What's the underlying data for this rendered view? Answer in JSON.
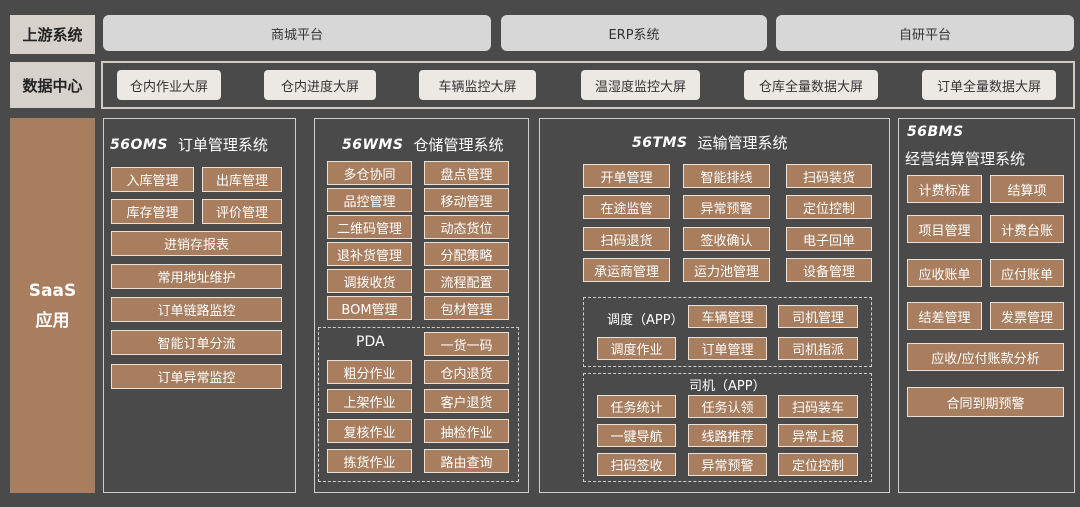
{
  "upstream": {
    "label": "上游系统",
    "platforms": [
      "商城平台",
      "ERP系统",
      "自研平台"
    ]
  },
  "datacenter": {
    "label": "数据中心",
    "items": [
      "仓内作业大屏",
      "仓内进度大屏",
      "车辆监控大屏",
      "温湿度监控大屏",
      "仓库全量数据大屏",
      "订单全量数据大屏"
    ]
  },
  "saas": {
    "line1": "SaaS",
    "line2": "应用"
  },
  "oms": {
    "logo": "56OMS",
    "title": "订单管理系统",
    "pairs": [
      [
        "入库管理",
        "出库管理"
      ],
      [
        "库存管理",
        "评价管理"
      ]
    ],
    "singles": [
      "进销存报表",
      "常用地址维护",
      "订单链路监控",
      "智能订单分流",
      "订单异常监控"
    ]
  },
  "wms": {
    "logo": "56WMS",
    "title": "仓储管理系统",
    "grid": [
      [
        "多仓协同",
        "盘点管理"
      ],
      [
        "品控管理",
        "移动管理"
      ],
      [
        "二维码管理",
        "动态货位"
      ],
      [
        "退补货管理",
        "分配策略"
      ],
      [
        "调拨收货",
        "流程配置"
      ],
      [
        "BOM管理",
        "包材管理"
      ]
    ],
    "pda_label": "PDA",
    "pda_top": "一货一码",
    "pda_grid": [
      [
        "粗分作业",
        "仓内退货"
      ],
      [
        "上架作业",
        "客户退货"
      ],
      [
        "复核作业",
        "抽检作业"
      ],
      [
        "拣货作业",
        "路由查询"
      ]
    ]
  },
  "tms": {
    "logo": "56TMS",
    "title": "运输管理系统",
    "grid": [
      [
        "开单管理",
        "智能排线",
        "扫码装货"
      ],
      [
        "在途监管",
        "异常预警",
        "定位控制"
      ],
      [
        "扫码退货",
        "签收确认",
        "电子回单"
      ],
      [
        "承运商管理",
        "运力池管理",
        "设备管理"
      ]
    ],
    "dispatch_label": "调度（APP）",
    "dispatch_row1": [
      "车辆管理",
      "司机管理"
    ],
    "dispatch_row2": [
      "调度作业",
      "订单管理",
      "司机指派"
    ],
    "driver_label": "司机（APP）",
    "driver_grid": [
      [
        "任务统计",
        "任务认领",
        "扫码装车"
      ],
      [
        "一键导航",
        "线路推荐",
        "异常上报"
      ],
      [
        "扫码签收",
        "异常预警",
        "定位控制"
      ]
    ]
  },
  "bms": {
    "logo": "56BMS",
    "title": "经营结算管理系统",
    "grid": [
      [
        "计费标准",
        "结算项"
      ],
      [
        "项目管理",
        "计费台账"
      ],
      [
        "应收账单",
        "应付账单"
      ],
      [
        "结差管理",
        "发票管理"
      ]
    ],
    "wide": [
      "应收/应付账款分析",
      "合同到期预警"
    ]
  }
}
